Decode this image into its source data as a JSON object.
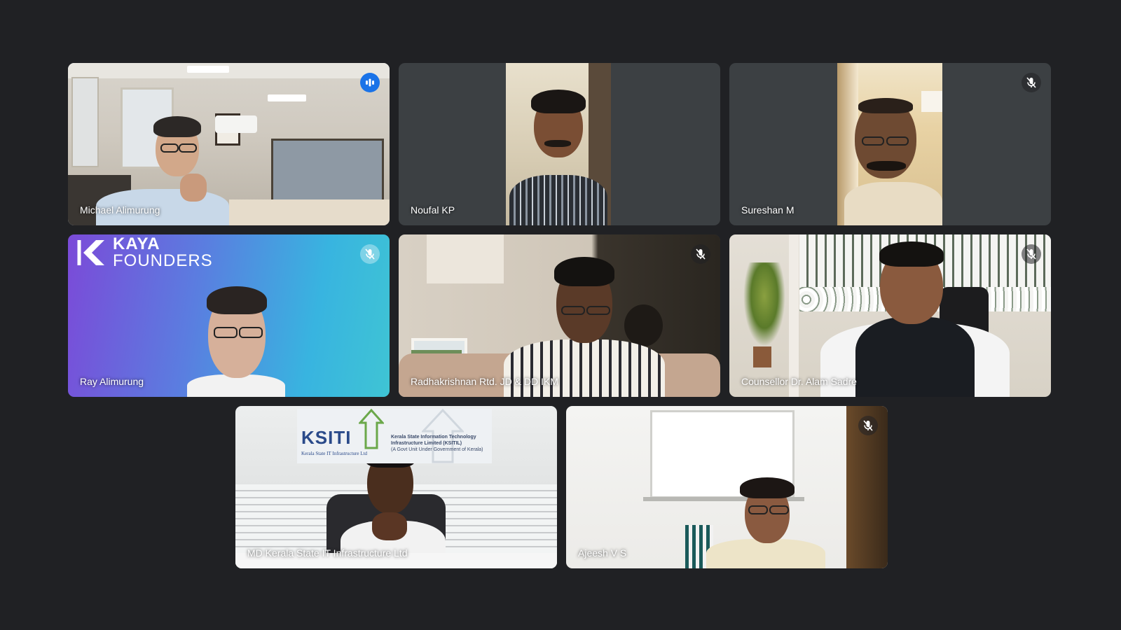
{
  "meeting": {
    "participants": [
      {
        "name": "Michael Alimurung",
        "status": "speaking"
      },
      {
        "name": "Noufal KP",
        "status": "none"
      },
      {
        "name": "Sureshan M",
        "status": "muted"
      },
      {
        "name": "Ray Alimurung",
        "status": "muted"
      },
      {
        "name": "Radhakrishnan Rtd. JD & DD IKM",
        "status": "muted"
      },
      {
        "name": "Counsellor Dr. Alam Sadre",
        "status": "muted"
      },
      {
        "name": "MD Kerala State IT Infrastructure Ltd",
        "status": "none"
      },
      {
        "name": "Ajeesh V S",
        "status": "muted"
      }
    ],
    "kaya_logo": {
      "line1": "KAYA",
      "line2": "FOUNDERS"
    },
    "ksitil_sign": {
      "brand": "KSITI",
      "tagline": "Kerala State IT Infrastructure Ltd",
      "full_name": "Kerala State Information Technology Infrastructure Limited (KSITIL)",
      "sub": "(A Govt Unit Under Government of Kerala)"
    }
  },
  "colors": {
    "background": "#202124",
    "tile_empty": "#3c4043",
    "active_border": "#8ab4f8",
    "speaking_badge": "#1a73e8"
  },
  "icons": {
    "speaking": "audio-wave-icon",
    "muted": "mic-off-icon"
  }
}
